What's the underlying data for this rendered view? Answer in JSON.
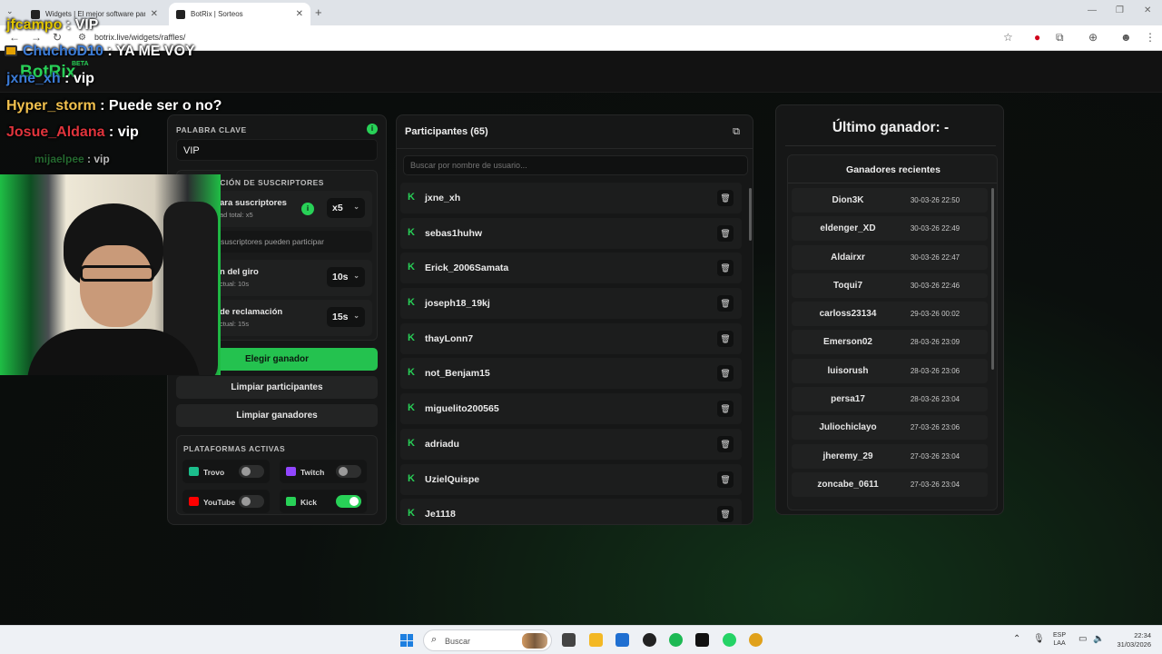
{
  "browser": {
    "tabs": [
      {
        "title": "Widgets | El mejor software para",
        "active": false
      },
      {
        "title": "BotRix | Sorteos",
        "active": true
      }
    ],
    "url": "botrix.live/widgets/raffles/"
  },
  "site": {
    "logo": "BotRix",
    "badge": "BETA"
  },
  "left_panel": {
    "keyword_label": "PALABRA CLAVE",
    "info_icon": "i",
    "keyword_value": "VIP",
    "subs_section_title": "RACIÓN DE SUSCRIPTORES",
    "subs_multiplier": {
      "title": "ara suscriptores",
      "sub": "ad total: x5",
      "value": "x5",
      "info_icon": "i"
    },
    "subs_only_note": "o suscriptores pueden participar",
    "spin_time": {
      "title": "n del giro",
      "sub": "ctual: 10s",
      "value": "10s"
    },
    "claim_time": {
      "title": "de reclamación",
      "sub": "ctual: 15s",
      "value": "15s"
    },
    "pick_winner": "Elegir ganador",
    "clear_participants": "Limpiar participantes",
    "clear_winners": "Limpiar ganadores",
    "platforms_title": "PLATAFORMAS ACTIVAS",
    "platforms": [
      {
        "name": "Trovo",
        "on": false,
        "icon": "trovo-icon",
        "color": "#1bbe8c"
      },
      {
        "name": "Twitch",
        "on": false,
        "icon": "twitch-icon",
        "color": "#9146ff"
      },
      {
        "name": "YouTube",
        "on": false,
        "icon": "youtube-icon",
        "color": "#ff0000"
      },
      {
        "name": "Kick",
        "on": true,
        "icon": "kick-icon",
        "color": "#28d157"
      }
    ]
  },
  "participants": {
    "title": "Participantes (65)",
    "search_placeholder": "Buscar por nombre de usuario...",
    "kick_glyph": "K",
    "trash_glyph": "🗑",
    "items": [
      "jxne_xh",
      "sebas1huhw",
      "Erick_2006Samata",
      "joseph18_19kj",
      "thayLonn7",
      "not_Benjam15",
      "miguelito200565",
      "adriadu",
      "UzielQuispe",
      "Je1118"
    ]
  },
  "winners": {
    "last_winner": "Último ganador: -",
    "recent_title": "Ganadores recientes",
    "items": [
      {
        "name": "Dion3K",
        "date": "30-03-26 22:50"
      },
      {
        "name": "eldenger_XD",
        "date": "30-03-26 22:49"
      },
      {
        "name": "Aldairxr",
        "date": "30-03-26 22:47"
      },
      {
        "name": "Toqui7",
        "date": "30-03-26 22:46"
      },
      {
        "name": "carloss23134",
        "date": "29-03-26 00:02"
      },
      {
        "name": "Emerson02",
        "date": "28-03-26 23:09"
      },
      {
        "name": "luisorush",
        "date": "28-03-26 23:06"
      },
      {
        "name": "persa17",
        "date": "28-03-26 23:04"
      },
      {
        "name": "Juliochiclayo",
        "date": "27-03-26 23:06"
      },
      {
        "name": "jheremy_29",
        "date": "27-03-26 23:04"
      },
      {
        "name": "zoncabe_0611",
        "date": "27-03-26 23:04"
      }
    ]
  },
  "overlay_chat": [
    {
      "user": "jfcampo",
      "message": "VIP",
      "color": "#e0c400"
    },
    {
      "user": "ChuchoD10",
      "message": "YA ME VOY",
      "color": "#3b7bd6"
    },
    {
      "user": "jxne_xh",
      "message": "vip",
      "color": "#3b7bd6"
    },
    {
      "user": "Hyper_storm",
      "message": "Puede ser o no?",
      "color": "#f2c14e"
    },
    {
      "user": "Josue_Aldana",
      "message": "vip",
      "color": "#e0343c"
    },
    {
      "user": "mijaelpee",
      "message": "vip",
      "color": "#2f8f3f"
    }
  ],
  "taskbar": {
    "search": "Buscar",
    "lang_top": "ESP",
    "lang_bottom": "LAA",
    "time": "22:34",
    "date": "31/03/2026"
  }
}
